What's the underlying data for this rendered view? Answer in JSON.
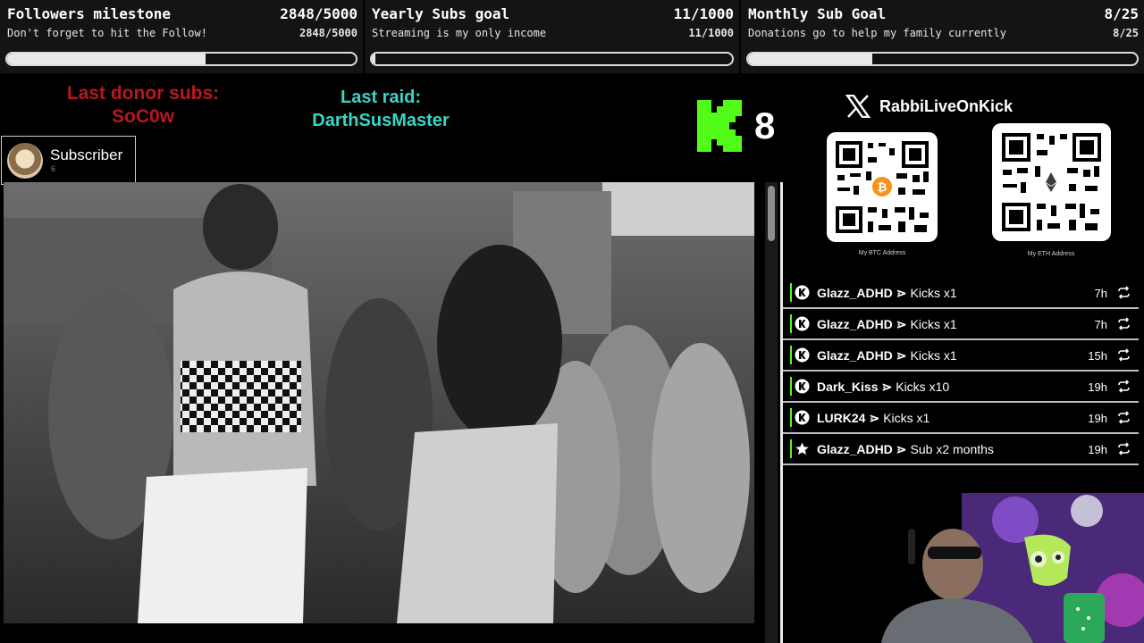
{
  "goals": [
    {
      "title": "Followers milestone",
      "count": "2848/5000",
      "subtitle": "Don't forget to hit the Follow!",
      "progress": 0.5696
    },
    {
      "title": "Yearly Subs goal",
      "count": "11/1000",
      "subtitle": "Streaming is my only income",
      "progress": 0.011
    },
    {
      "title": "Monthly Sub Goal",
      "count": "8/25",
      "subtitle": "Donations go to help my family currently",
      "progress": 0.32
    }
  ],
  "last_donor": {
    "label": "Last donor subs:",
    "name": "SoC0w"
  },
  "last_raid": {
    "label": "Last raid:",
    "name": "DarthSusMaster"
  },
  "kick": {
    "count": "8",
    "brand_color": "#53fc18"
  },
  "subscriber": {
    "label": "Subscriber",
    "count": "6"
  },
  "x_handle": {
    "name": "RabbiLiveOnKick"
  },
  "qr_codes": [
    {
      "caption": "My BTC Address",
      "coin": "bitcoin",
      "color": "#f7931a"
    },
    {
      "caption": "My ETH Address",
      "coin": "ethereum",
      "color": "#3c3c3d"
    }
  ],
  "feed": [
    {
      "icon": "kick-icon",
      "user": "Glazz_ADHD",
      "sep": "⋗",
      "action": "Kicks x1",
      "time": "7h"
    },
    {
      "icon": "kick-icon",
      "user": "Glazz_ADHD",
      "sep": "⋗",
      "action": "Kicks x1",
      "time": "7h"
    },
    {
      "icon": "kick-icon",
      "user": "Glazz_ADHD",
      "sep": "⋗",
      "action": "Kicks x1",
      "time": "15h"
    },
    {
      "icon": "kick-icon",
      "user": "Dark_Kiss",
      "sep": "⋗",
      "action": "Kicks x10",
      "time": "19h"
    },
    {
      "icon": "kick-icon",
      "user": "LURK24",
      "sep": "⋗",
      "action": "Kicks x1",
      "time": "19h"
    },
    {
      "icon": "star-icon",
      "user": "Glazz_ADHD",
      "sep": "⋗",
      "action": "Sub x2 months",
      "time": "19h"
    }
  ],
  "colors": {
    "donor": "#b8181e",
    "raid": "#38d6c4",
    "feed_accent": "#53fc18"
  }
}
